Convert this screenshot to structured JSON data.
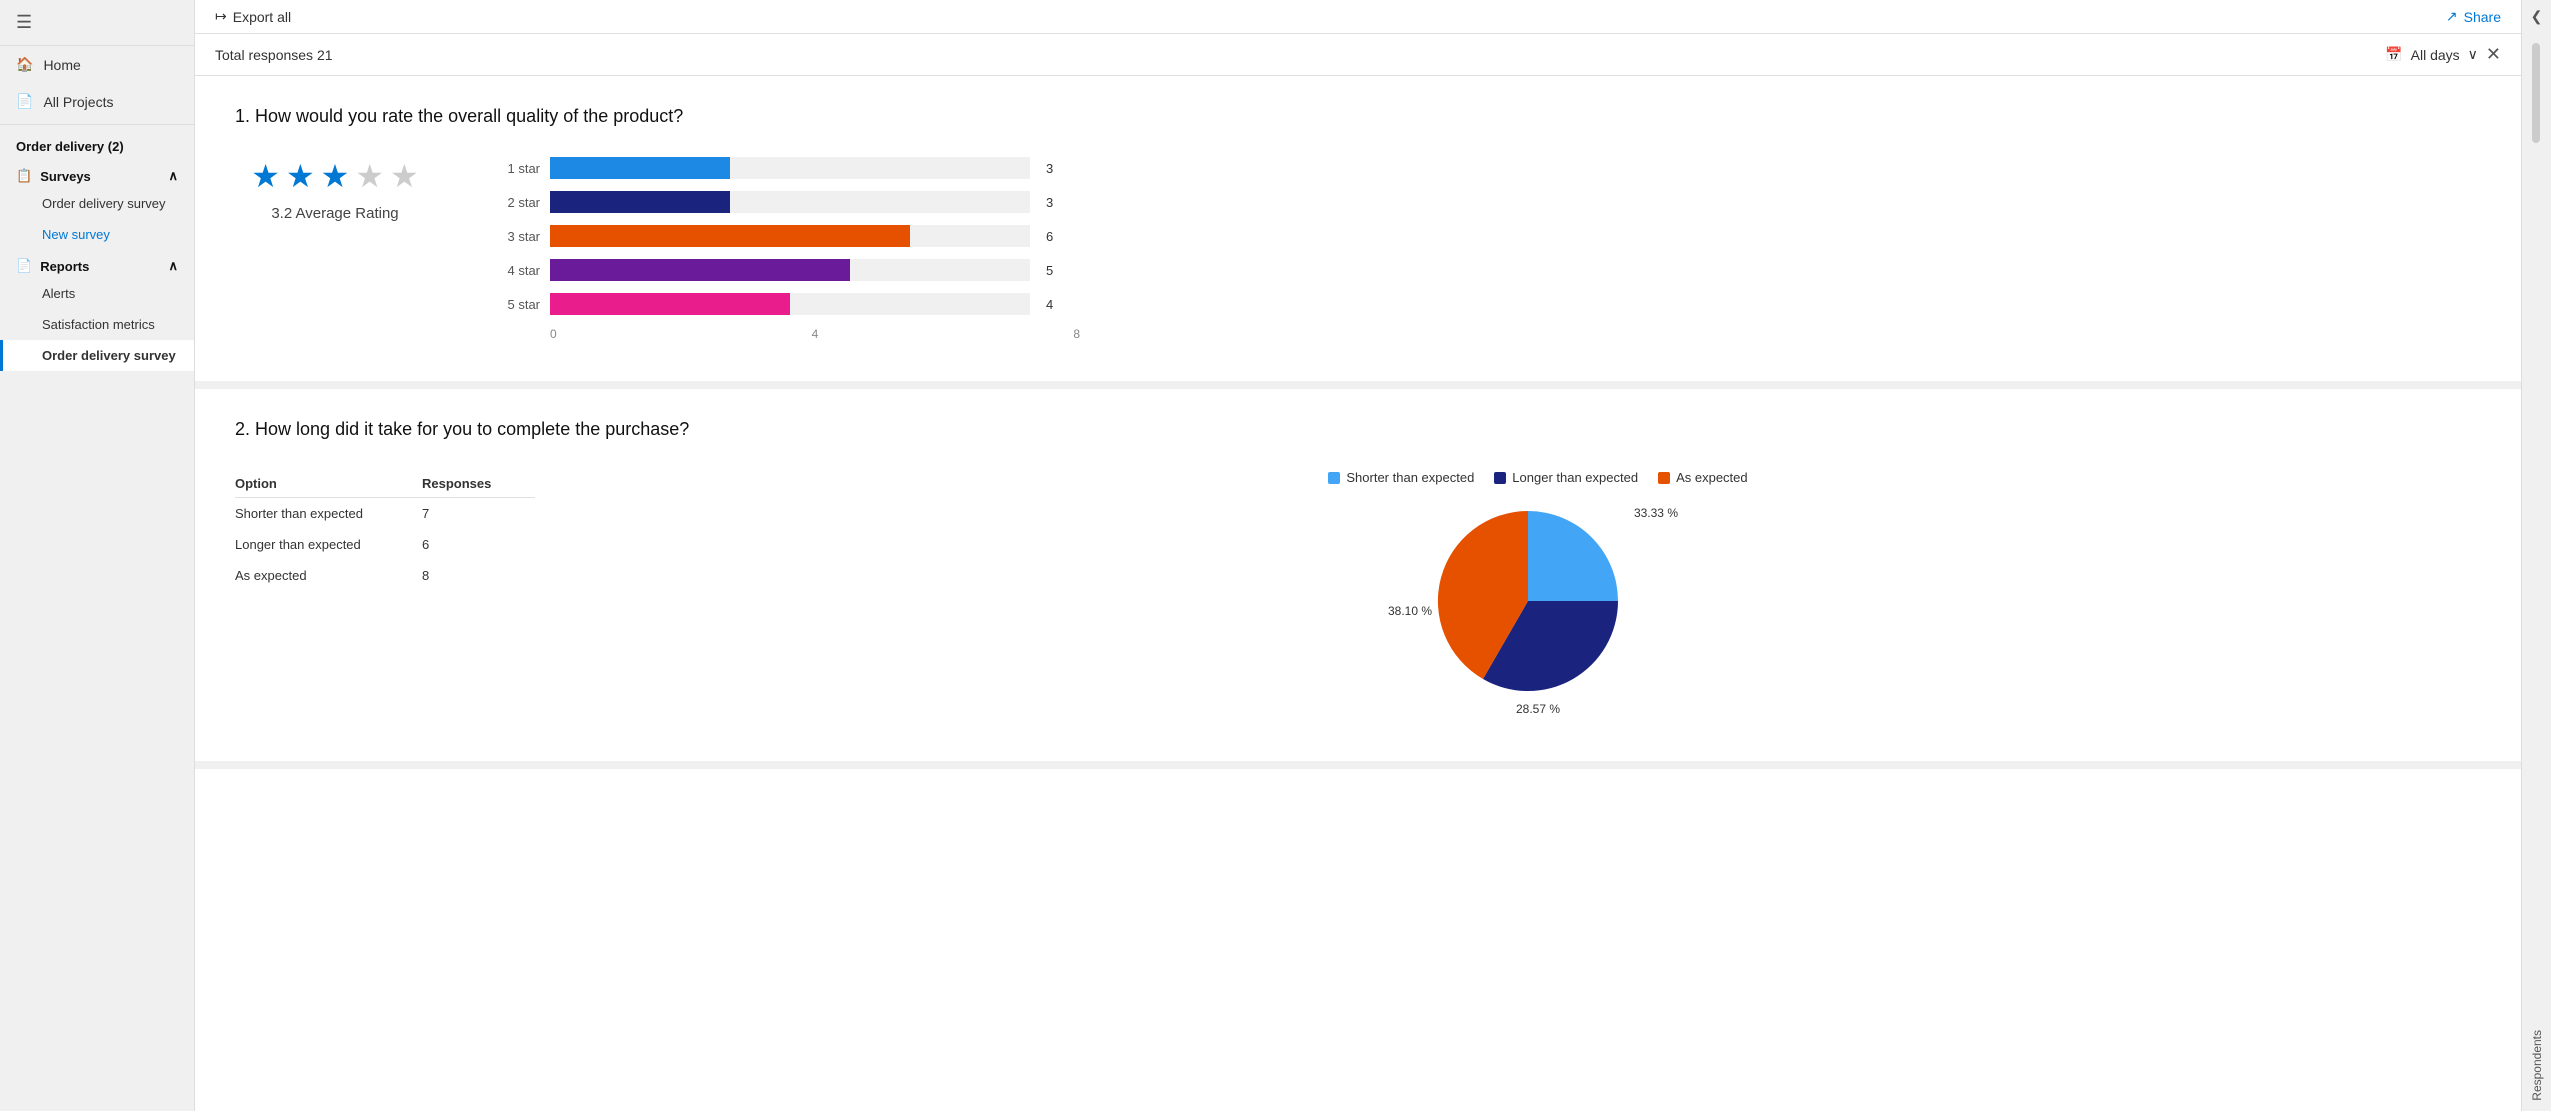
{
  "sidebar": {
    "hamburger": "☰",
    "nav": [
      {
        "id": "home",
        "label": "Home",
        "icon": "🏠"
      },
      {
        "id": "all-projects",
        "label": "All Projects",
        "icon": "📄"
      }
    ],
    "section": {
      "title": "Order delivery (2)",
      "surveys_label": "Surveys",
      "surveys_items": [
        {
          "id": "order-delivery-survey",
          "label": "Order delivery survey"
        },
        {
          "id": "new-survey",
          "label": "New survey",
          "active_blue": true
        }
      ],
      "reports_label": "Reports",
      "reports_items": [
        {
          "id": "alerts",
          "label": "Alerts"
        },
        {
          "id": "satisfaction-metrics",
          "label": "Satisfaction metrics"
        },
        {
          "id": "order-delivery-survey-report",
          "label": "Order delivery survey",
          "active_selected": true
        }
      ]
    }
  },
  "topbar": {
    "export_label": "Export all",
    "share_label": "Share"
  },
  "responses": {
    "total_label": "Total responses 21",
    "filter_label": "All days"
  },
  "q1": {
    "number": "1.",
    "title": "How would you rate the overall quality of the product?",
    "stars_filled": 3,
    "stars_total": 5,
    "avg_label": "3.2 Average Rating",
    "bars": [
      {
        "label": "1 star",
        "value": 3,
        "max": 8,
        "color": "#1E88E5"
      },
      {
        "label": "2 star",
        "value": 3,
        "max": 8,
        "color": "#1A237E"
      },
      {
        "label": "3 star",
        "value": 6,
        "max": 8,
        "color": "#E65100"
      },
      {
        "label": "4 star",
        "value": 5,
        "max": 8,
        "color": "#6A1B9A"
      },
      {
        "label": "5 star",
        "value": 4,
        "max": 8,
        "color": "#E91E8C"
      }
    ],
    "axis_labels": [
      "0",
      "4",
      "8"
    ]
  },
  "q2": {
    "number": "2.",
    "title": "How long did it take for you to complete the purchase?",
    "table": {
      "headers": [
        "Option",
        "Responses"
      ],
      "rows": [
        {
          "option": "Shorter than expected",
          "responses": "7"
        },
        {
          "option": "Longer than expected",
          "responses": "6"
        },
        {
          "option": "As expected",
          "responses": "8"
        }
      ]
    },
    "pie": {
      "legend": [
        {
          "label": "Shorter than expected",
          "color": "#42A5F5"
        },
        {
          "label": "Longer than expected",
          "color": "#1A237E"
        },
        {
          "label": "As expected",
          "color": "#E65100"
        }
      ],
      "slices": [
        {
          "label": "33.33 %",
          "color": "#42A5F5",
          "percent": 33.33,
          "position": "right"
        },
        {
          "label": "28.57 %",
          "color": "#1A237E",
          "percent": 28.57,
          "position": "bottom"
        },
        {
          "label": "38.10 %",
          "color": "#E65100",
          "percent": 38.1,
          "position": "left"
        }
      ]
    }
  },
  "respondents_tab": "Respondents"
}
